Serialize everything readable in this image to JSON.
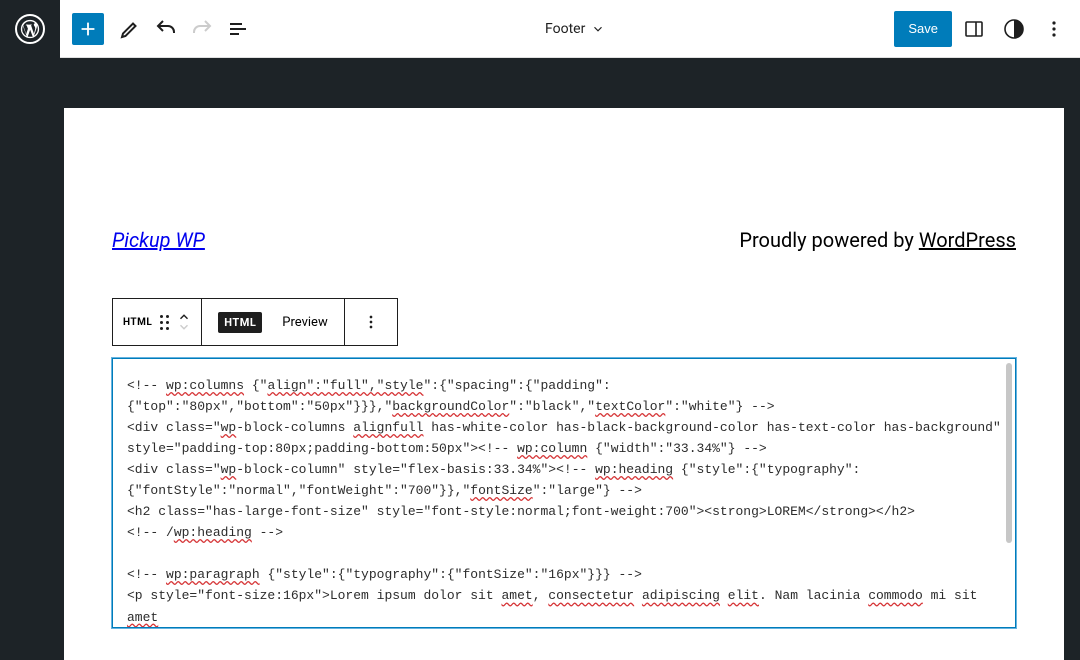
{
  "toolbar": {
    "template_name": "Footer",
    "save_label": "Save"
  },
  "footer": {
    "site_title": "Pickup WP",
    "powered_prefix": "Proudly powered by ",
    "powered_link": "WordPress"
  },
  "block_toolbar": {
    "type_label": "HTML",
    "tab_html": "HTML",
    "tab_preview": "Preview"
  },
  "code": {
    "l1a": "<!-- ",
    "l1b": "wp:columns",
    "l1c": " {\"",
    "l1d": "align\":\"full\",\"style",
    "l1e": "\":{\"spacing\":{\"padding\":",
    "l2a": "{\"top\":\"80px\",\"bottom\":\"50px\"}}},\"",
    "l2b": "backgroundColor",
    "l2c": "\":\"black\",\"",
    "l2d": "textColor",
    "l2e": "\":\"white\"} -->",
    "l3a": "<div class=\"",
    "l3b": "wp",
    "l3c": "-block-columns ",
    "l3d": "alignfull",
    "l3e": " has-white-color has-black-background-color has-text-color has-background\"",
    "l4a": "style=\"padding-top:80px;padding-bottom:50px\"><!-- ",
    "l4b": "wp:column",
    "l4c": " {\"width\":\"33.34%\"} -->",
    "l5a": "<div class=\"",
    "l5b": "wp",
    "l5c": "-block-column\" style=\"flex-basis:33.34%\"><!-- ",
    "l5d": "wp:heading",
    "l5e": " {\"style\":{\"typography\":",
    "l6a": "{\"fontStyle\":\"normal\",\"fontWeight\":\"700\"}},\"",
    "l6b": "fontSize",
    "l6c": "\":\"large\"} -->",
    "l7": "<h2 class=\"has-large-font-size\" style=\"font-style:normal;font-weight:700\"><strong>LOREM</strong></h2>",
    "l8a": "<!-- /",
    "l8b": "wp:heading",
    "l8c": " -->",
    "l9": "",
    "l10a": "<!-- ",
    "l10b": "wp:paragraph",
    "l10c": " {\"style\":{\"typography\":{\"fontSize\":\"16px\"}}} -->",
    "l11a": "<p style=\"font-size:16px\">Lorem ipsum dolor sit ",
    "l11b": "amet",
    "l11c": ", ",
    "l11d": "consectetur",
    "l11e": " ",
    "l11f": "adipiscing",
    "l11g": " ",
    "l11h": "elit",
    "l11i": ". Nam lacinia ",
    "l11j": "commodo",
    "l11k": " mi sit ",
    "l11l": "amet"
  },
  "icons": {
    "add": "add-icon",
    "edit": "pencil-icon",
    "undo": "undo-icon",
    "redo": "redo-icon",
    "details": "list-view-icon",
    "chevron": "chevron-down-icon",
    "sidebar": "sidebar-toggle-icon",
    "styles": "styles-icon",
    "more": "more-vertical-icon"
  }
}
